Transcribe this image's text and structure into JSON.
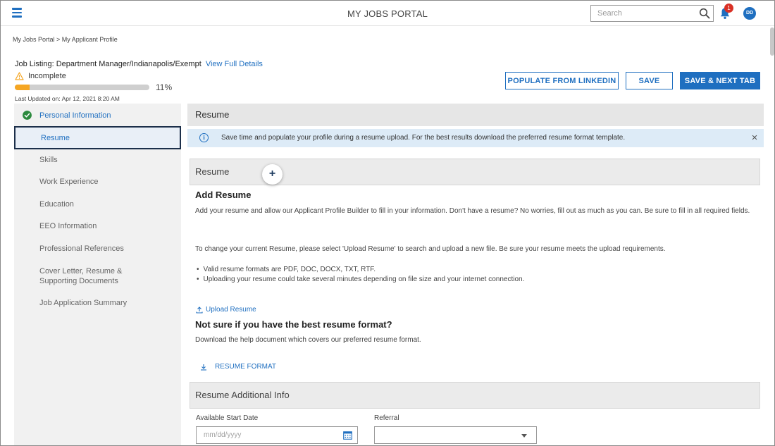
{
  "header": {
    "app_title": "MY JOBS PORTAL",
    "search_placeholder": "Search",
    "notification_count": "1",
    "avatar_initials": "DD"
  },
  "breadcrumb": "My Jobs Portal > My Applicant Profile",
  "job_listing": {
    "label": "Job Listing: Department Manager/Indianapolis/Exempt",
    "link": "View Full Details"
  },
  "status": {
    "text": "Incomplete",
    "percent_label": "11%",
    "progress": 0.11,
    "last_updated": "Last Updated on: Apr 12, 2021 8:20 AM"
  },
  "actions": {
    "populate": "POPULATE FROM LINKEDIN",
    "save": "SAVE",
    "save_next": "SAVE & NEXT TAB"
  },
  "sidebar": {
    "items": [
      {
        "label": "Personal Information"
      },
      {
        "label": "Resume"
      },
      {
        "label": "Skills"
      },
      {
        "label": "Work Experience"
      },
      {
        "label": "Education"
      },
      {
        "label": "EEO Information"
      },
      {
        "label": "Professional References"
      },
      {
        "label": "Cover Letter, Resume & Supporting Documents"
      },
      {
        "label": "Job Application Summary"
      }
    ]
  },
  "main": {
    "header": "Resume",
    "banner": "Save time and populate your profile during a resume upload. For the best results download the preferred resume format template.",
    "section_resume": "Resume",
    "add_resume_title": "Add Resume",
    "add_resume_text": "Add your resume and allow our Applicant Profile Builder to fill in your information. Don't have a resume? No worries, fill out as much as you can. Be sure to fill in all required fields.",
    "change_text": "To change your current Resume, please select 'Upload Resume' to search and upload a new file. Be sure your resume meets the upload requirements.",
    "bullets": [
      "Valid resume formats are PDF, DOC, DOCX, TXT, RTF.",
      "Uploading your resume could take several minutes depending on file size and your internet connection."
    ],
    "upload_link": "Upload Resume",
    "format_title": "Not sure if you have the best resume format?",
    "format_text": "Download the help document which covers our preferred resume format.",
    "format_link": "RESUME FORMAT",
    "additional_header": "Resume Additional Info",
    "start_date_label": "Available Start Date",
    "start_date_placeholder": "mm/dd/yyyy",
    "referral_label": "Referral",
    "referral_value": ""
  },
  "colors": {
    "accent": "#1f6fc0",
    "progress": "#f5a623",
    "success": "#2c8a3e",
    "banner_bg": "#ddebf7",
    "badge": "#d93025"
  },
  "icons": [
    "hamburger-icon",
    "search-icon",
    "bell-icon",
    "warning-icon",
    "check-icon",
    "info-icon",
    "close-icon",
    "plus-icon",
    "upload-icon",
    "download-icon",
    "calendar-icon",
    "chevron-down-icon"
  ]
}
